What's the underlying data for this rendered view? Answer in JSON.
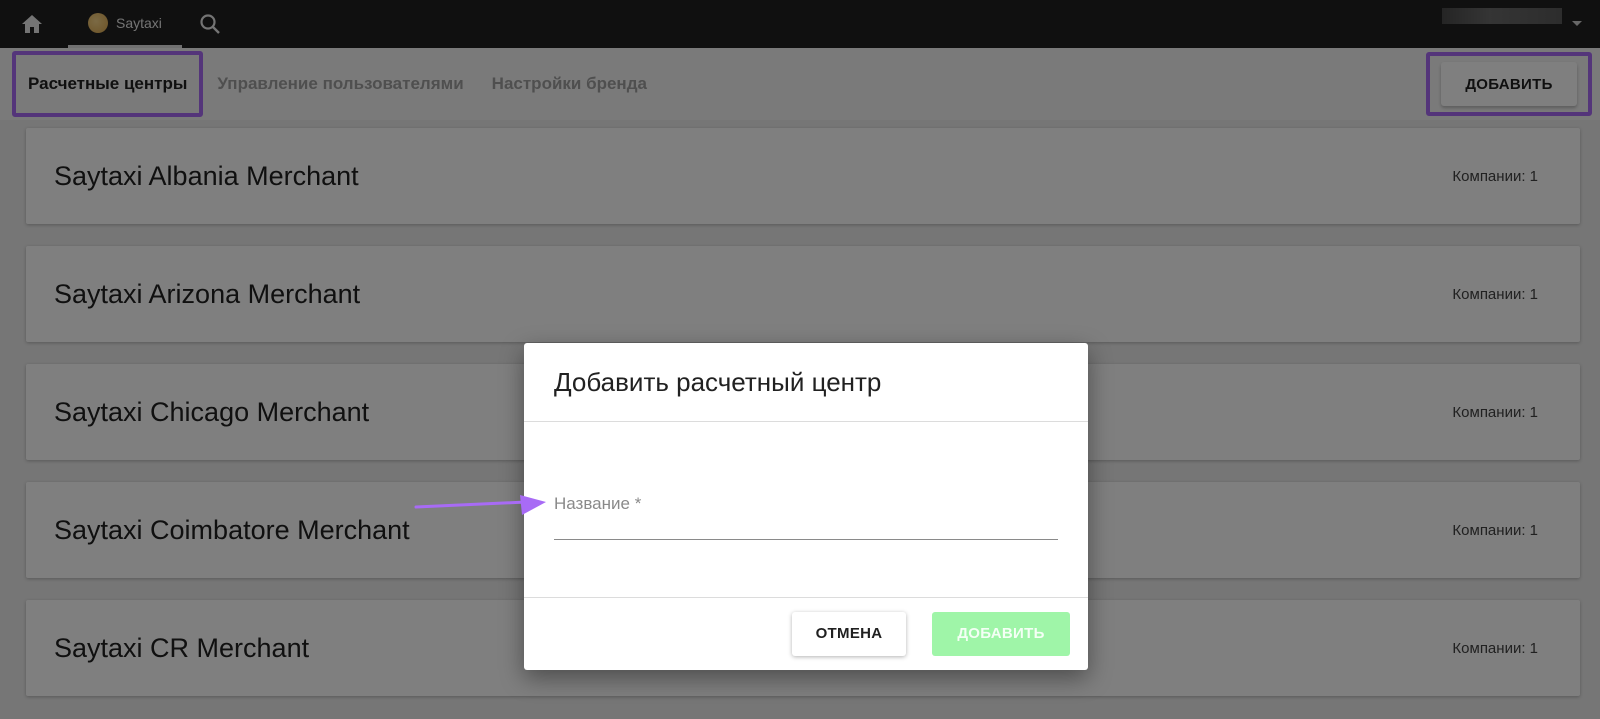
{
  "topbar": {
    "home_icon": "home-icon",
    "app_tab_label": "Saytaxi",
    "search_icon": "search-icon"
  },
  "subnav": {
    "tabs": [
      {
        "label": "Расчетные центры",
        "active": true
      },
      {
        "label": "Управление пользователями",
        "active": false
      },
      {
        "label": "Настройки бренда",
        "active": false
      }
    ],
    "add_button_label": "ДОБАВИТЬ"
  },
  "merchants": [
    {
      "name": "Saytaxi Albania Merchant",
      "count": "Компании: 1"
    },
    {
      "name": "Saytaxi Arizona Merchant",
      "count": "Компании: 1"
    },
    {
      "name": "Saytaxi Chicago Merchant",
      "count": "Компании: 1"
    },
    {
      "name": "Saytaxi Coimbatore Merchant",
      "count": "Компании: 1"
    },
    {
      "name": "Saytaxi CR Merchant",
      "count": "Компании: 1"
    }
  ],
  "dialog": {
    "title": "Добавить расчетный центр",
    "field_label": "Название *",
    "field_value": "",
    "cancel_label": "ОТМЕНА",
    "submit_label": "ДОБАВИТЬ"
  },
  "colors": {
    "highlight": "#a86bf5",
    "topbar": "#212121",
    "submit_disabled": "#9ff5a8"
  }
}
